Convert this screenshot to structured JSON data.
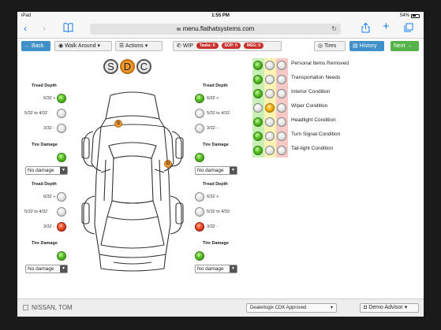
{
  "status_bar": {
    "device": "iPad",
    "time": "1:55 PM",
    "battery": "54%"
  },
  "browser": {
    "url": "menu.flathatsystems.com"
  },
  "toolbar": {
    "back": "Back",
    "walk_around": "Walk Around",
    "actions": "Actions",
    "wip": "WIP",
    "tasks": "Tasks: 0",
    "sop": "SOP: 0",
    "msg": "MSG: 0",
    "tires": "Tires",
    "history": "History",
    "next": "Next"
  },
  "sdc": [
    "S",
    "D",
    "C"
  ],
  "sdc_active": "D",
  "tires": {
    "tread_title": "Tread Depth",
    "damage_title": "Tire Damage",
    "frac_top": "6/32 +",
    "frac_mid": "5/32 to 4/32",
    "frac_low": "3/32 -",
    "damage_value": "No damage",
    "front_left": {
      "tread": [
        "green",
        "gray",
        "gray"
      ],
      "damage": "green"
    },
    "front_right": {
      "tread": [
        "green",
        "gray",
        "gray"
      ],
      "damage": "green"
    },
    "rear_left": {
      "tread": [
        "gray",
        "gray",
        "red"
      ],
      "damage": "green"
    },
    "rear_right": {
      "tread": [
        "gray",
        "gray",
        "red"
      ],
      "damage": "green"
    }
  },
  "car_markers": [
    "S",
    "D"
  ],
  "conditions": [
    {
      "label": "Personal Items Removed",
      "state": "green"
    },
    {
      "label": "Transportation Needs",
      "state": "green"
    },
    {
      "label": "Interior Condition",
      "state": "green"
    },
    {
      "label": "Wiper Condition",
      "state": "yellow"
    },
    {
      "label": "Headlight Condition",
      "state": "green"
    },
    {
      "label": "Turn Signal Condition",
      "state": "green"
    },
    {
      "label": "Tail-light Condition",
      "state": "green"
    }
  ],
  "condition_colors": {
    "green": "#c8f0b4",
    "yellow": "#fbf3b4",
    "red": "#f7c9c6"
  },
  "footer": {
    "customer": "NISSAN, TOM",
    "status_select": "Dealerlogix CDK Approved",
    "advisor": "Demo Advisor"
  }
}
